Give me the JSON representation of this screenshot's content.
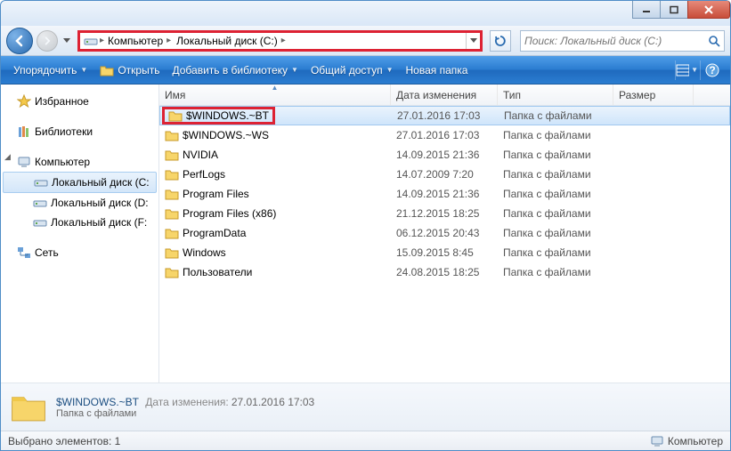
{
  "breadcrumb": {
    "segments": [
      "Компьютер",
      "Локальный диск (C:)"
    ]
  },
  "search": {
    "placeholder": "Поиск: Локальный диск (C:)"
  },
  "toolbar": {
    "organize": "Упорядочить",
    "open": "Открыть",
    "add_to_library": "Добавить в библиотеку",
    "share": "Общий доступ",
    "new_folder": "Новая папка"
  },
  "columns": {
    "name": "Имя",
    "date": "Дата изменения",
    "type": "Тип",
    "size": "Размер"
  },
  "sidebar": {
    "favorites": "Избранное",
    "libraries": "Библиотеки",
    "computer": "Компьютер",
    "drives": [
      "Локальный диск (C:",
      "Локальный диск (D:",
      "Локальный диск (F:"
    ],
    "network": "Сеть"
  },
  "files": [
    {
      "name": "$WINDOWS.~BT",
      "date": "27.01.2016 17:03",
      "type": "Папка с файлами",
      "selected": true,
      "highlighted": true
    },
    {
      "name": "$WINDOWS.~WS",
      "date": "27.01.2016 17:03",
      "type": "Папка с файлами"
    },
    {
      "name": "NVIDIA",
      "date": "14.09.2015 21:36",
      "type": "Папка с файлами"
    },
    {
      "name": "PerfLogs",
      "date": "14.07.2009 7:20",
      "type": "Папка с файлами"
    },
    {
      "name": "Program Files",
      "date": "14.09.2015 21:36",
      "type": "Папка с файлами"
    },
    {
      "name": "Program Files (x86)",
      "date": "21.12.2015 18:25",
      "type": "Папка с файлами"
    },
    {
      "name": "ProgramData",
      "date": "06.12.2015 20:43",
      "type": "Папка с файлами"
    },
    {
      "name": "Windows",
      "date": "15.09.2015 8:45",
      "type": "Папка с файлами"
    },
    {
      "name": "Пользователи",
      "date": "24.08.2015 18:25",
      "type": "Папка с файлами"
    }
  ],
  "details": {
    "name": "$WINDOWS.~BT",
    "date_label": "Дата изменения:",
    "date": "27.01.2016 17:03",
    "type": "Папка с файлами"
  },
  "status": {
    "selected": "Выбрано элементов: 1",
    "location": "Компьютер"
  }
}
